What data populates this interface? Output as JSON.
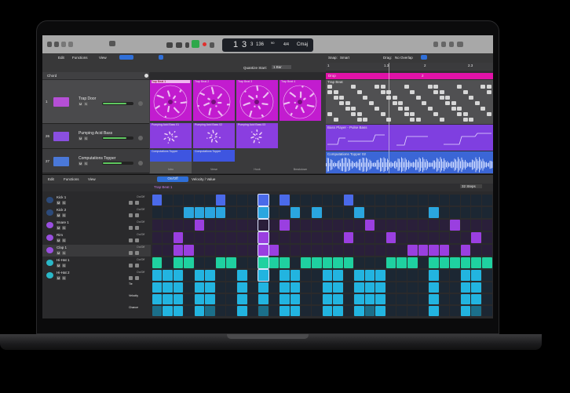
{
  "transport": {
    "position": [
      "1",
      "3",
      "3",
      "136"
    ],
    "tempo": "90",
    "time_signature": "4/4",
    "key": "Cmaj"
  },
  "tracks_toolbar": {
    "edit": "Edit",
    "functions": "Functions",
    "view": "View",
    "quantize_label": "Quantize Start:",
    "quantize_value": "1 Bar",
    "snap_label": "Snap:",
    "snap_value": "Smart",
    "drag_label": "Drag:",
    "drag_value": "No Overlap"
  },
  "chord_label": "Chord",
  "tracks": [
    {
      "num": "1",
      "name": "Trap Door",
      "color": "#b54fd6"
    },
    {
      "num": "26",
      "name": "Pumping Acid Bass",
      "color": "#8a4fe0"
    },
    {
      "num": "27",
      "name": "Computations Topper",
      "color": "#4a78d8"
    }
  ],
  "live_loops": {
    "row1": [
      "Trap Beat 1",
      "Trap Beat 2",
      "Trap Beat 3",
      "Trap Beat 4"
    ],
    "row2": [
      "Pumping Acid Bass 01",
      "Pumping Acid Bass 02",
      "Pumping Acid Bass 03"
    ],
    "row3": [
      "Computations Topper",
      "Computations Topper"
    ],
    "scenes": [
      "Intro",
      "Verse",
      "Hook",
      "Breakdown"
    ],
    "colors": {
      "drums": "#c21ccf",
      "bass": "#8a3ee0",
      "topper": "#3e55e0"
    }
  },
  "arrange": {
    "ruler": [
      "1",
      "1.3",
      "2",
      "2.3"
    ],
    "marker": "Drop",
    "marker_num": "2",
    "region1": "Trap Beat",
    "region2": "Bass Player - Pulse Bass",
    "region3": "Computations Topper 02"
  },
  "step_seq": {
    "edit": "Edit",
    "functions": "Functions",
    "view": "View",
    "mode_tabs": [
      "On/Off",
      "Velocity / Value"
    ],
    "steps_label": "32 Steps",
    "pattern_name": "Trap Beat 1",
    "num_steps": 32,
    "playhead_step": 10,
    "rows": [
      {
        "name": "Kick 1",
        "mode": "On/Off",
        "color": "#4a6aea",
        "on": [
          0,
          6,
          10,
          12,
          18
        ]
      },
      {
        "name": "Kick 2",
        "mode": "On/Off",
        "color": "#2aa6df",
        "on": [
          3,
          4,
          5,
          6,
          10,
          13,
          15,
          19,
          26
        ]
      },
      {
        "name": "Snare 1",
        "mode": "On/Off",
        "color": "#9a3fe0",
        "on": [
          4,
          12,
          20,
          28
        ]
      },
      {
        "name": "Rim",
        "mode": "On/Off",
        "color": "#9a3fe0",
        "on": [
          2,
          10,
          18,
          22,
          30
        ]
      },
      {
        "name": "Clap 1",
        "mode": "On/Off",
        "color": "#9a3fe0",
        "on": [
          2,
          3,
          10,
          11,
          24,
          25,
          26,
          27,
          29
        ]
      },
      {
        "name": "Hi-Hat 1",
        "mode": "On/Off",
        "color": "#1fd1a0",
        "on": [
          0,
          2,
          3,
          6,
          7,
          10,
          11,
          12,
          14,
          15,
          16,
          17,
          18,
          22,
          23,
          24,
          26,
          27,
          28,
          29,
          30,
          31
        ]
      },
      {
        "name": "Hi-Hat 2",
        "mode": "On/Off",
        "color": "#22b4e0",
        "on": [
          0,
          1,
          2,
          4,
          5,
          8,
          10,
          12,
          13,
          16,
          17,
          19,
          20,
          21,
          26,
          29,
          30
        ]
      }
    ],
    "sub_rows": [
      "Tie",
      "Velocity",
      "Chance"
    ]
  }
}
